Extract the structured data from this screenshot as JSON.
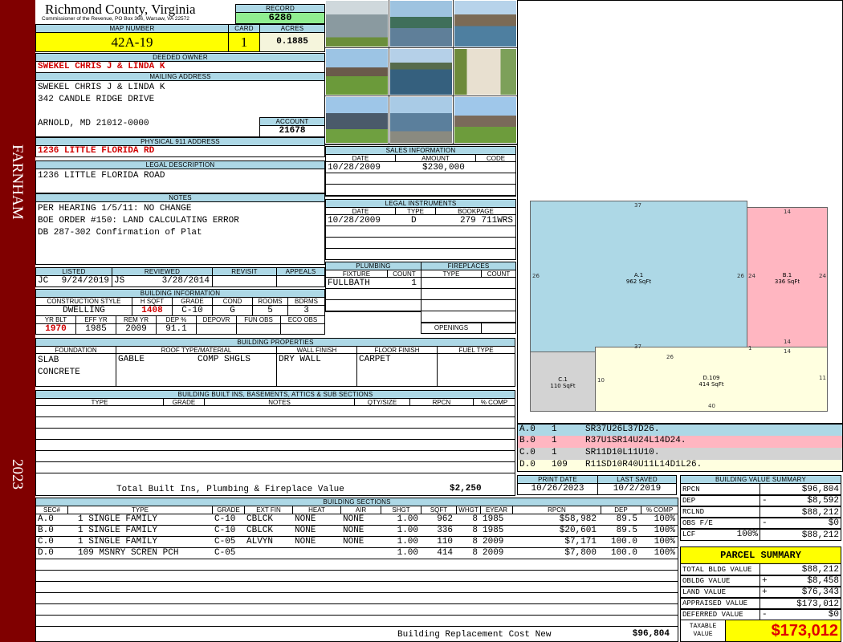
{
  "sidebar": {
    "district": "FARNHAM",
    "year": "2023"
  },
  "header": {
    "title": "Richmond County, Virginia",
    "subtitle": "Commissioner of the Revenue, PO Box 366, Warsaw, VA 22572",
    "record_label": "RECORD",
    "record": "6280"
  },
  "parcel": {
    "map_label": "MAP NUMBER",
    "map": "42A-19",
    "card_label": "CARD",
    "card": "1",
    "acres_label": "ACRES",
    "acres": "0.1885"
  },
  "owner": {
    "label": "DEEDED OWNER",
    "name": "SWEKEL CHRIS J & LINDA K",
    "mail_label": "MAILING ADDRESS",
    "mail1": "SWEKEL CHRIS J & LINDA K",
    "mail2": "342 CANDLE RIDGE DRIVE",
    "mail3": "ARNOLD, MD 21012-0000",
    "account_label": "ACCOUNT",
    "account": "21678",
    "phys_label": "PHYSICAL 911 ADDRESS",
    "phys": "1236 LITTLE FLORIDA RD"
  },
  "legal": {
    "label": "LEGAL DESCRIPTION",
    "text": "1236 LITTLE FLORIDA ROAD"
  },
  "notes": {
    "label": "NOTES",
    "lines": [
      "PER HEARING 1/5/11: NO CHANGE",
      "BOE ORDER #150: LAND CALCULATING ERROR",
      "DB 287-302 Confirmation of Plat"
    ]
  },
  "review": {
    "listed_label": "LISTED",
    "reviewed_label": "REVIEWED",
    "revisit_label": "REVISIT",
    "appeals_label": "APPEALS",
    "listed_by": "JC",
    "listed_date": "9/24/2019",
    "reviewed_by": "JS",
    "reviewed_date": "3/28/2014"
  },
  "building_info": {
    "label": "BUILDING INFORMATION",
    "headers1": [
      "CONSTRUCTION STYLE",
      "H SQFT",
      "GRADE",
      "COND",
      "ROOMS",
      "BDRMS"
    ],
    "values1": [
      "DWELLING",
      "1408",
      "C-10",
      "G",
      "5",
      "3"
    ],
    "headers2": [
      "YR BLT",
      "EFF YR",
      "REM YR",
      "DEP %",
      "DEPOVR",
      "FUN OBS",
      "ECO OBS"
    ],
    "values2": [
      "1970",
      "1985",
      "2009",
      "91.1"
    ]
  },
  "properties": {
    "label": "BUILDING PROPERTIES",
    "headers": [
      "FOUNDATION",
      "ROOF TYPE/MATERIAL",
      "WALL FINISH",
      "FLOOR FINISH",
      "FUEL TYPE"
    ],
    "foundation1": "SLAB",
    "foundation2": "CONCRETE",
    "roof_type": "GABLE",
    "roof_material": "COMP SHGLS",
    "wall": "DRY WALL",
    "floor": "CARPET"
  },
  "builtins": {
    "label": "BUILDING BUILT INS, BASEMENTS, ATTICS & SUB SECTIONS",
    "headers": [
      "TYPE",
      "GRADE",
      "NOTES",
      "QTY/SIZE",
      "RPCN",
      "% COMP"
    ],
    "total_label": "Total Built Ins, Plumbing & Fireplace Value",
    "total": "$2,250"
  },
  "sales": {
    "label": "SALES INFORMATION",
    "headers": [
      "DATE",
      "AMOUNT",
      "CODE"
    ],
    "date": "10/28/2009",
    "amount": "$230,000"
  },
  "instruments": {
    "label": "LEGAL INSTRUMENTS",
    "headers": [
      "DATE",
      "TYPE",
      "BOOKPAGE"
    ],
    "date": "10/28/2009",
    "type": "D",
    "bookpage": "279 711WRS"
  },
  "plumbing": {
    "label": "PLUMBING",
    "headers": [
      "FIXTURE",
      "COUNT"
    ],
    "fixture": "FULLBATH",
    "count": "1"
  },
  "fireplaces": {
    "label": "FIREPLACES",
    "headers": [
      "TYPE",
      "COUNT"
    ],
    "openings": "OPENINGS"
  },
  "sketch": {
    "areas": [
      {
        "name": "A.1",
        "sqft": "962 SqFt",
        "color": "#add8e6"
      },
      {
        "name": "B.1",
        "sqft": "336 SqFt",
        "color": "#ffb6c1"
      },
      {
        "name": "C.1",
        "sqft": "110 SqFt",
        "color": "#d3d3d3"
      },
      {
        "name": "D.109",
        "sqft": "414 SqFt",
        "color": "#ffffe0"
      }
    ],
    "dims": {
      "a_top": "37",
      "a_left": "26",
      "a_right": "26",
      "a_bottom": "37",
      "b_top": "14",
      "b_left": "24",
      "b_right": "24",
      "b_bottom": "14",
      "b_step": "1",
      "d_top": "26",
      "d_top2": "14",
      "c_right": "10",
      "d_right": "11",
      "d_bottom": "40"
    },
    "codes": [
      {
        "sec": "A.0",
        "n": "1",
        "code": "SR37U26L37D26."
      },
      {
        "sec": "B.0",
        "n": "1",
        "code": "R37U1SR14U24L14D24."
      },
      {
        "sec": "C.0",
        "n": "1",
        "code": "SR11D10L11U10."
      },
      {
        "sec": "D.0",
        "n": "109",
        "code": "R11SD10R40U11L14D1L26."
      }
    ]
  },
  "dates": {
    "print_label": "PRINT DATE",
    "print": "10/26/2023",
    "saved_label": "LAST SAVED",
    "saved": "10/2/2019"
  },
  "value_summary": {
    "label": "BUILDING VALUE SUMMARY",
    "rpcn_l": "RPCN",
    "rpcn": "$96,804",
    "dep_l": "DEP",
    "dep": "$8,592",
    "rclnd_l": "RCLND",
    "rclnd": "$88,212",
    "obs_l": "OBS F/E",
    "obs": "$0",
    "lcf_l": "LCF",
    "lcf_pct": "100%",
    "lcf": "$88,212",
    "minus": "-"
  },
  "parcel_summary": {
    "title": "PARCEL SUMMARY",
    "total_l": "TOTAL BLDG VALUE",
    "total": "$88,212",
    "obldg_l": "OBLDG VALUE",
    "obldg": "$8,458",
    "land_l": "LAND VALUE",
    "land": "$76,343",
    "appraised_l": "APPRAISED VALUE",
    "appraised": "$173,012",
    "deferred_l": "DEFERRED VALUE",
    "deferred": "$0",
    "taxable_l1": "TAXABLE",
    "taxable_l2": "VALUE",
    "taxable": "$173,012",
    "plus": "+",
    "minus": "-"
  },
  "sections": {
    "label": "BUILDING SECTIONS",
    "headers": [
      "SEC#",
      "TYPE",
      "GRADE",
      "EXT FIN",
      "HEAT",
      "AIR",
      "SHGT",
      "SQFT",
      "WHGT",
      "EYEAR",
      "RPCN",
      "DEP",
      "% COMP"
    ],
    "rows": [
      [
        "A.0",
        "1 SINGLE FAMILY",
        "C-10",
        "CBLCK",
        "NONE",
        "NONE",
        "1.00",
        "962",
        "8",
        "1985",
        "$58,982",
        "89.5",
        "100%"
      ],
      [
        "B.0",
        "1 SINGLE FAMILY",
        "C-10",
        "CBLCK",
        "NONE",
        "NONE",
        "1.00",
        "336",
        "8",
        "1985",
        "$20,601",
        "89.5",
        "100%"
      ],
      [
        "C.0",
        "1 SINGLE FAMILY",
        "C-05",
        "ALVYN",
        "NONE",
        "NONE",
        "1.00",
        "110",
        "8",
        "2009",
        "$7,171",
        "100.0",
        "100%"
      ],
      [
        "D.0",
        "109 MSNRY SCREN PCH",
        "C-05",
        "",
        "",
        "",
        "1.00",
        "414",
        "8",
        "2009",
        "$7,800",
        "100.0",
        "100%"
      ]
    ],
    "footer_label": "Building Replacement Cost New",
    "footer": "$96,804"
  }
}
